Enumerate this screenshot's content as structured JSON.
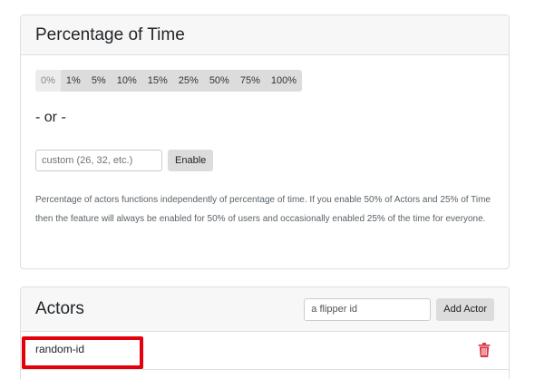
{
  "percentage_card": {
    "title": "Percentage of Time",
    "options": [
      {
        "label": "0%",
        "active": true
      },
      {
        "label": "1%",
        "active": false
      },
      {
        "label": "5%",
        "active": false
      },
      {
        "label": "10%",
        "active": false
      },
      {
        "label": "15%",
        "active": false
      },
      {
        "label": "25%",
        "active": false
      },
      {
        "label": "50%",
        "active": false
      },
      {
        "label": "75%",
        "active": false
      },
      {
        "label": "100%",
        "active": false
      }
    ],
    "or_text": "- or -",
    "custom_placeholder": "custom (26, 32, etc.)",
    "enable_label": "Enable",
    "help_text": "Percentage of actors functions independently of percentage of time. If you enable 50% of Actors and 25% of Time then the feature will always be enabled for 50% of users and occasionally enabled 25% of the time for everyone."
  },
  "actors_card": {
    "title": "Actors",
    "input_placeholder": "a flipper id",
    "add_label": "Add Actor",
    "actors": [
      {
        "name": "random-id",
        "delete_icon": "trash-icon"
      }
    ]
  },
  "colors": {
    "highlight": "#e3000b",
    "trash": "#dc3545"
  }
}
